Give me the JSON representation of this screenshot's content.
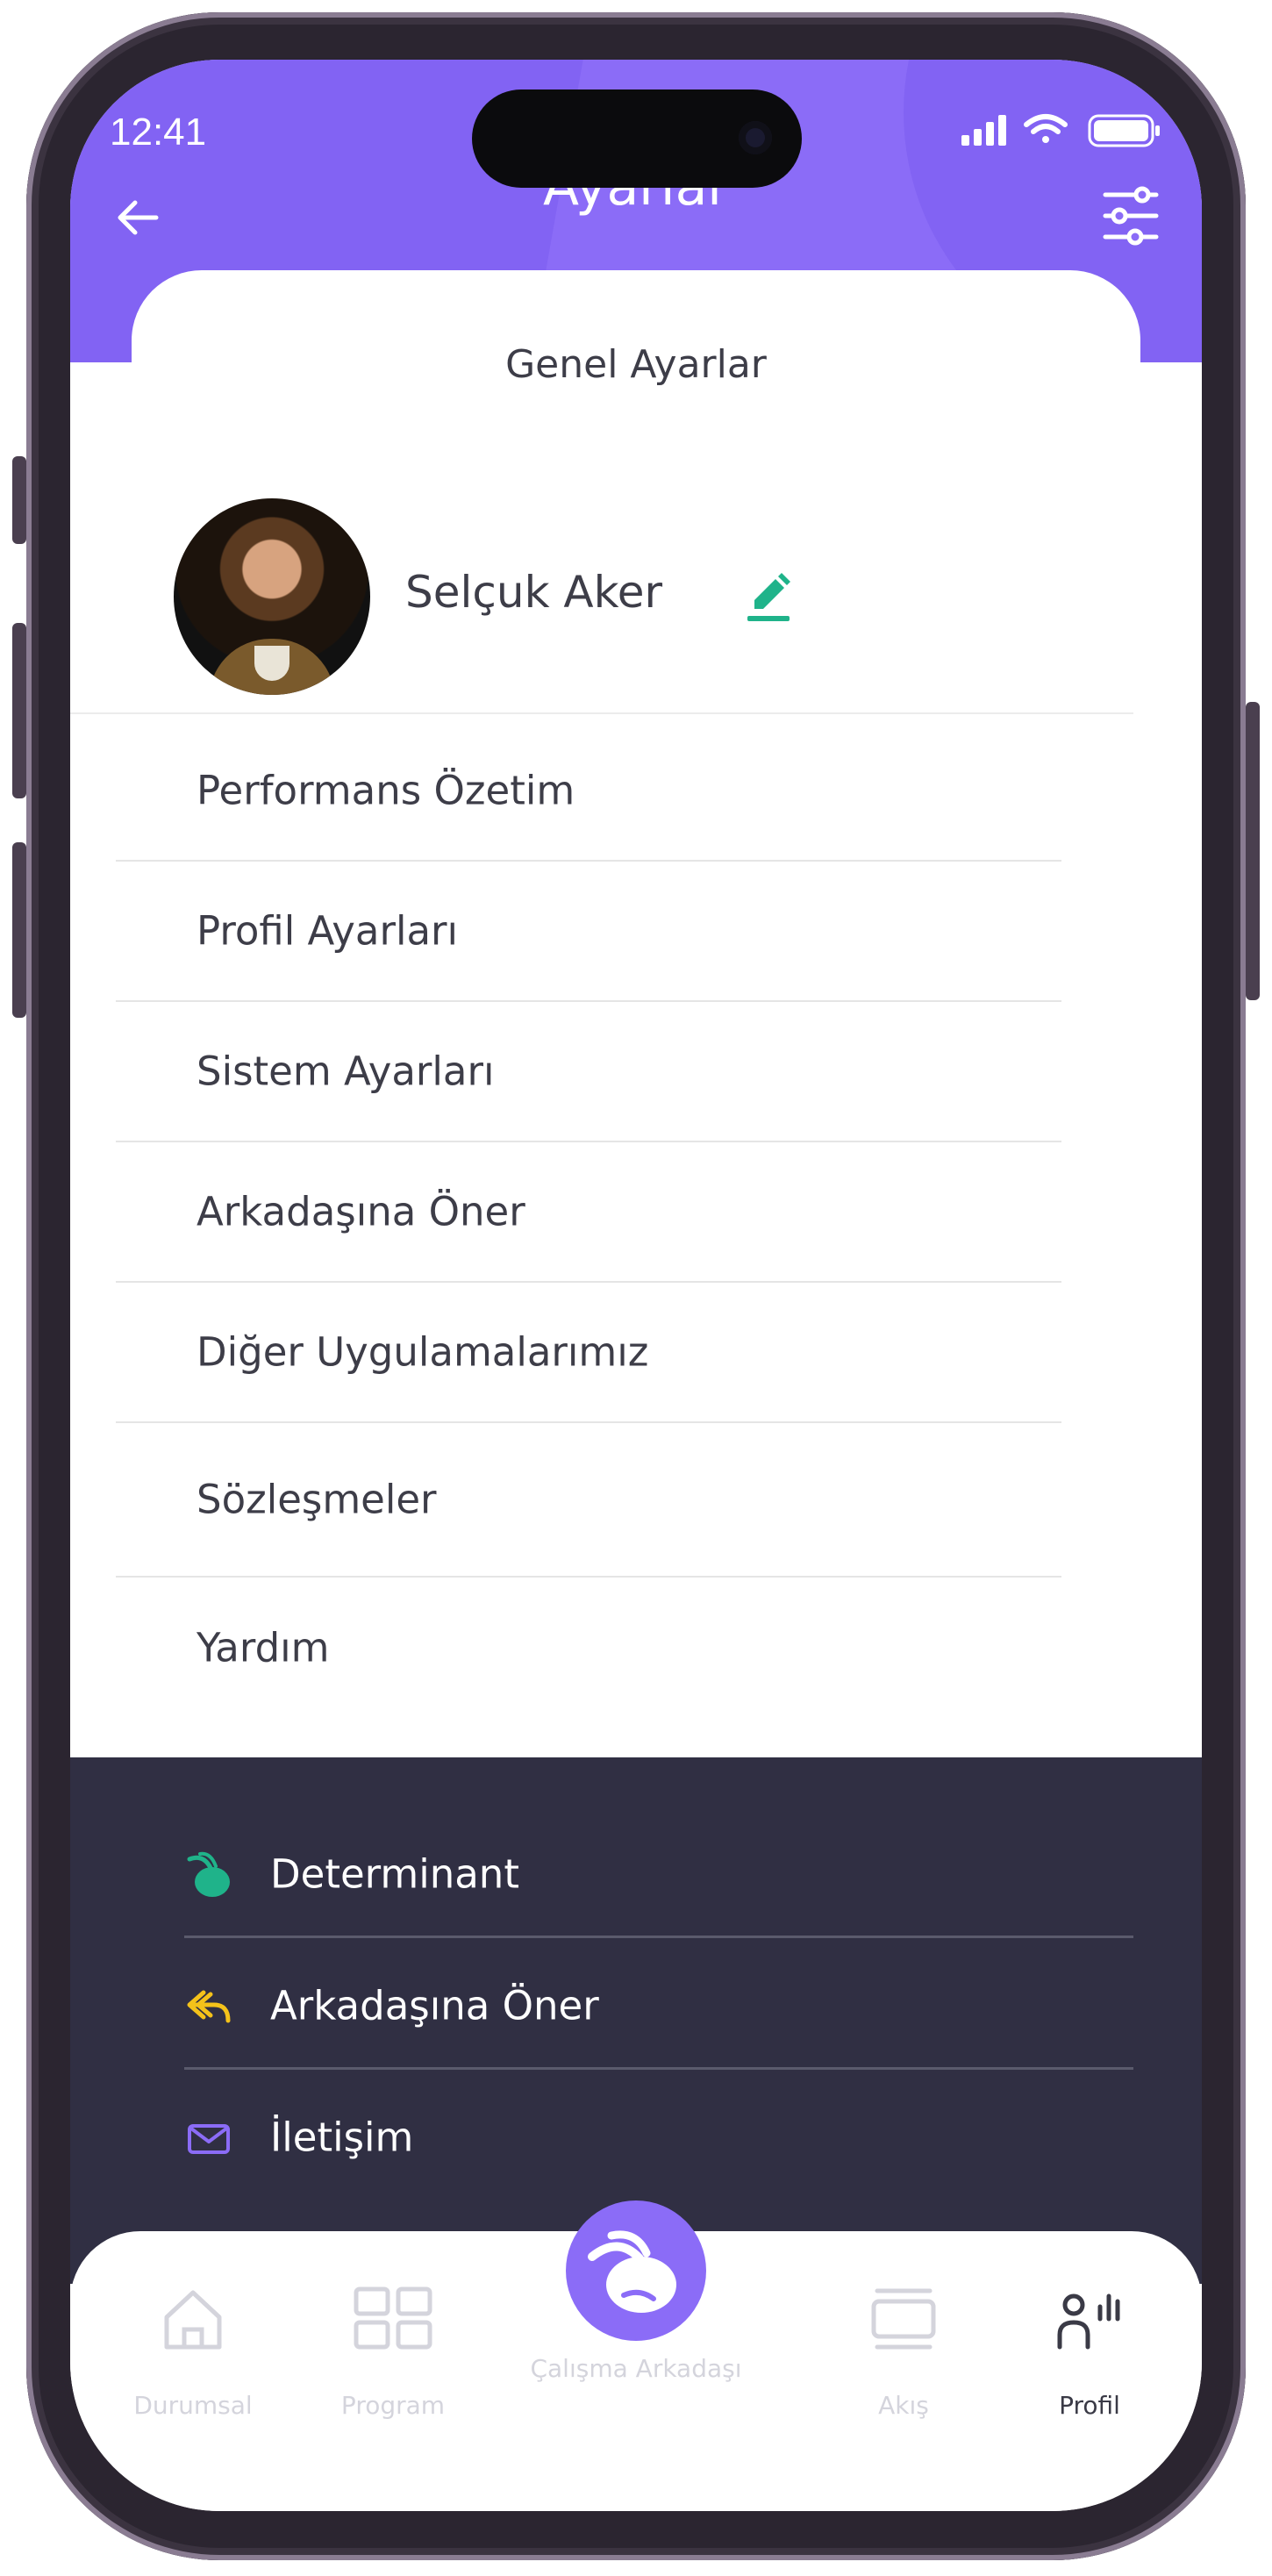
{
  "status_bar": {
    "time": "12:41"
  },
  "header": {
    "title": "Ayarlar"
  },
  "section_title": "Genel Ayarlar",
  "profile": {
    "name": "Selçuk Aker"
  },
  "menu": [
    {
      "label": "Performans Özetim"
    },
    {
      "label": "Profil Ayarları"
    },
    {
      "label": "Sistem Ayarları"
    },
    {
      "label": "Arkadaşına Öner"
    },
    {
      "label": "Diğer Uygulamalarımız"
    },
    {
      "label": "Sözleşmeler"
    },
    {
      "label": "Yardım"
    }
  ],
  "footer_links": [
    {
      "label": "Determinant",
      "icon": "determinant-logo-icon",
      "color": "#1fb38a"
    },
    {
      "label": "Arkadaşına Öner",
      "icon": "share-arrow-icon",
      "color": "#f4c21a"
    },
    {
      "label": "İletişim",
      "icon": "mail-icon",
      "color": "#8b6cf7"
    }
  ],
  "tabs": {
    "durumsal": "Durumsal",
    "program": "Program",
    "center": "Çalışma Arkadaşı",
    "akis": "Akış",
    "profil": "Profil"
  },
  "colors": {
    "primary": "#8b6cf7",
    "accent_green": "#1fb38a",
    "dark_panel": "#302f43"
  }
}
